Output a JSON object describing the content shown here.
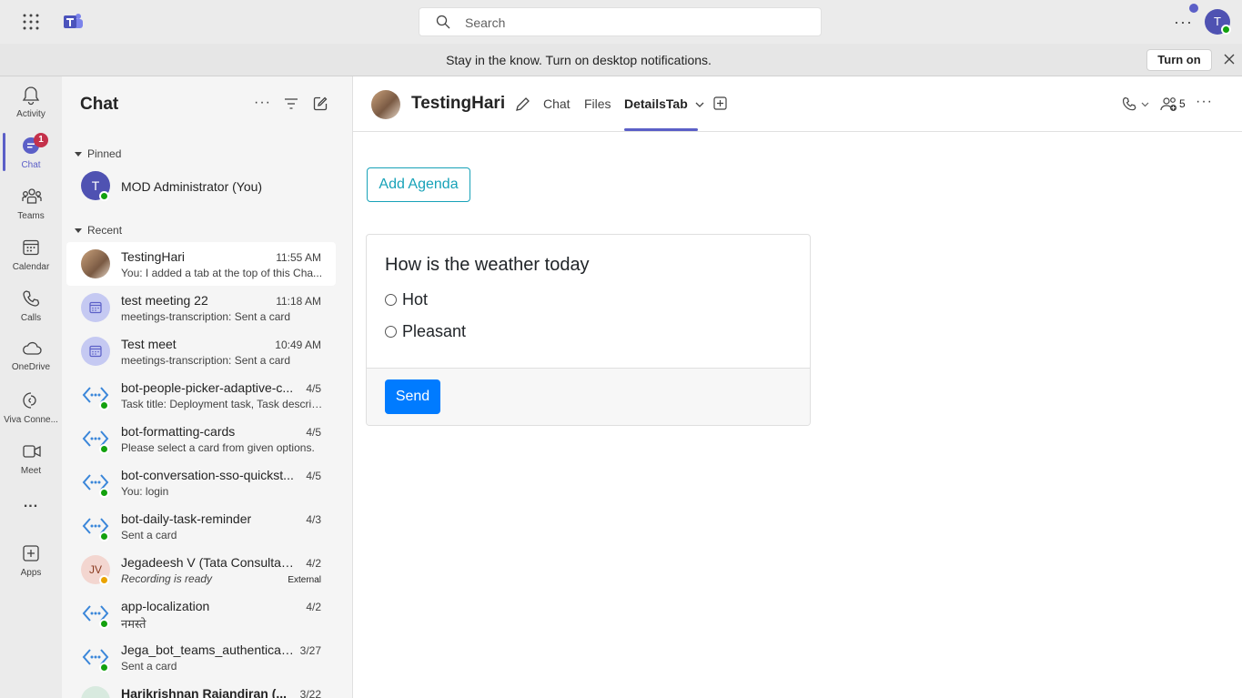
{
  "search": {
    "placeholder": "Search"
  },
  "notification": {
    "message": "Stay in the know. Turn on desktop notifications.",
    "action": "Turn on"
  },
  "rail": {
    "items": [
      {
        "label": "Activity"
      },
      {
        "label": "Chat",
        "badge": "1"
      },
      {
        "label": "Teams"
      },
      {
        "label": "Calendar"
      },
      {
        "label": "Calls"
      },
      {
        "label": "OneDrive"
      },
      {
        "label": "Viva Conne..."
      },
      {
        "label": "Meet"
      },
      {
        "label": "..."
      },
      {
        "label": "Apps"
      }
    ]
  },
  "user": {
    "initial": "T"
  },
  "chatlist": {
    "title": "Chat",
    "pinned_label": "Pinned",
    "recent_label": "Recent",
    "pinned": {
      "name": "MOD Administrator (You)",
      "initial": "T"
    },
    "items": [
      {
        "name": "TestingHari",
        "time": "11:55 AM",
        "preview": "You: I added a tab at the top of this Cha..."
      },
      {
        "name": "test meeting 22",
        "time": "11:18 AM",
        "preview": "meetings-transcription: Sent a card"
      },
      {
        "name": "Test meet",
        "time": "10:49 AM",
        "preview": "meetings-transcription: Sent a card"
      },
      {
        "name": "bot-people-picker-adaptive-c...",
        "time": "4/5",
        "preview": "Task title: Deployment task, Task descrip..."
      },
      {
        "name": "bot-formatting-cards",
        "time": "4/5",
        "preview": "Please select a card from given options."
      },
      {
        "name": "bot-conversation-sso-quickst...",
        "time": "4/5",
        "preview": "You: login"
      },
      {
        "name": "bot-daily-task-reminder",
        "time": "4/3",
        "preview": "Sent a card"
      },
      {
        "name": "Jegadeesh V (Tata Consultanc...",
        "time": "4/2",
        "preview": "Recording is ready",
        "tag": "External",
        "initials": "JV"
      },
      {
        "name": "app-localization",
        "time": "4/2",
        "preview": "नमस्ते"
      },
      {
        "name": "Jega_bot_teams_authenticati...",
        "time": "3/27",
        "preview": "Sent a card"
      },
      {
        "name": "Harikrishnan Rajandiran (...",
        "time": "3/22",
        "preview": ""
      }
    ]
  },
  "header": {
    "title": "TestingHari",
    "tabs": [
      "Chat",
      "Files",
      "DetailsTab"
    ],
    "participants": "5"
  },
  "content": {
    "agenda_button": "Add Agenda",
    "question": "How is the weather today",
    "options": [
      "Hot",
      "Pleasant"
    ],
    "send_button": "Send"
  },
  "colors": {
    "accent": "#5b5fc7",
    "send": "#007bff",
    "agenda": "#17a2b8"
  }
}
